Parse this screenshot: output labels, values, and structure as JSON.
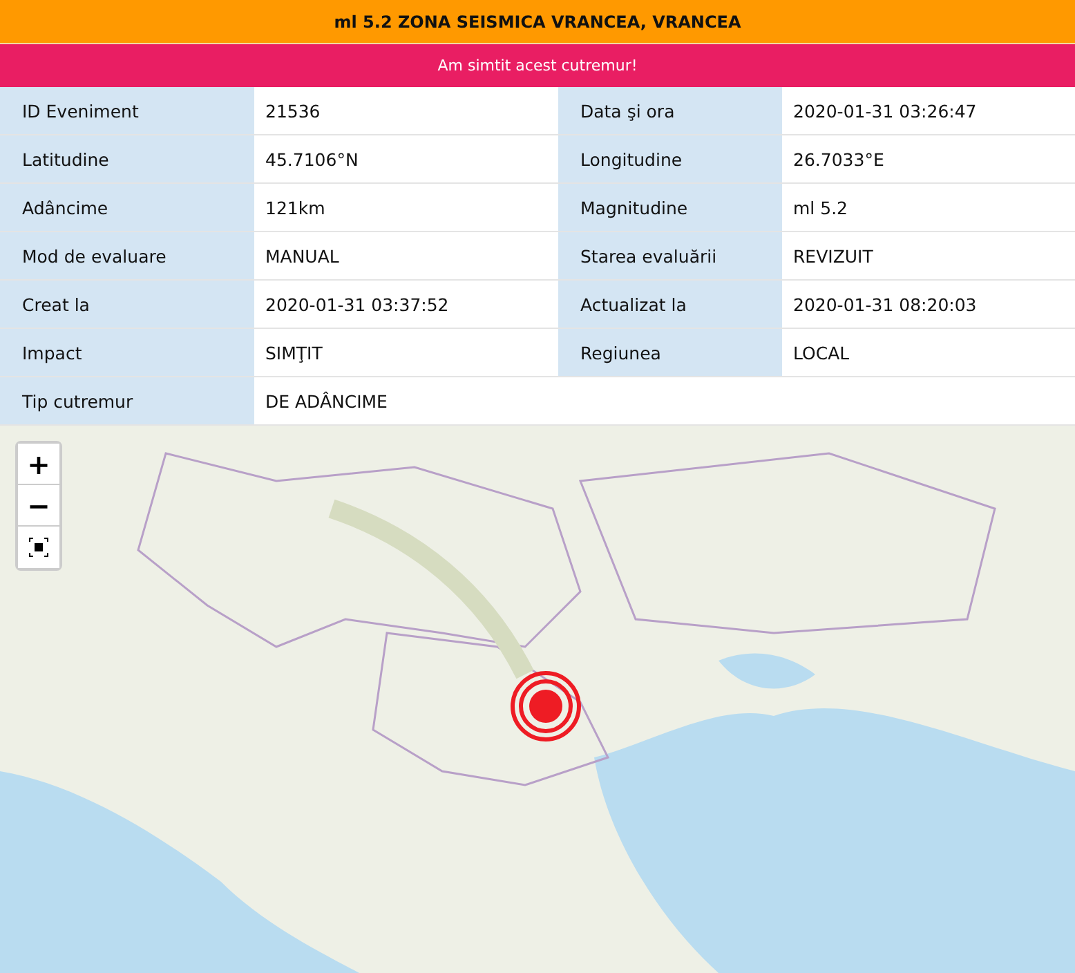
{
  "title": "ml 5.2 ZONA SEISMICA VRANCEA, VRANCEA",
  "felt_button": "Am simtit acest cutremur!",
  "details": [
    [
      {
        "label": "ID Eveniment",
        "value": "21536"
      },
      {
        "label": "Data şi ora",
        "value": "2020-01-31 03:26:47"
      }
    ],
    [
      {
        "label": "Latitudine",
        "value": "45.7106°N"
      },
      {
        "label": "Longitudine",
        "value": "26.7033°E"
      }
    ],
    [
      {
        "label": "Adâncime",
        "value": "121km"
      },
      {
        "label": "Magnitudine",
        "value": "ml 5.2"
      }
    ],
    [
      {
        "label": "Mod de evaluare",
        "value": "MANUAL"
      },
      {
        "label": "Starea evaluării",
        "value": "REVIZUIT"
      }
    ],
    [
      {
        "label": "Creat la",
        "value": "2020-01-31 03:37:52"
      },
      {
        "label": "Actualizat la",
        "value": "2020-01-31 08:20:03"
      }
    ],
    [
      {
        "label": "Impact",
        "value": "SIMŢIT"
      },
      {
        "label": "Regiunea",
        "value": "LOCAL"
      }
    ],
    [
      {
        "label": "Tip cutremur",
        "value": "DE ADÂNCIME"
      }
    ]
  ],
  "map": {
    "zoom_in": "+",
    "zoom_out": "−"
  }
}
